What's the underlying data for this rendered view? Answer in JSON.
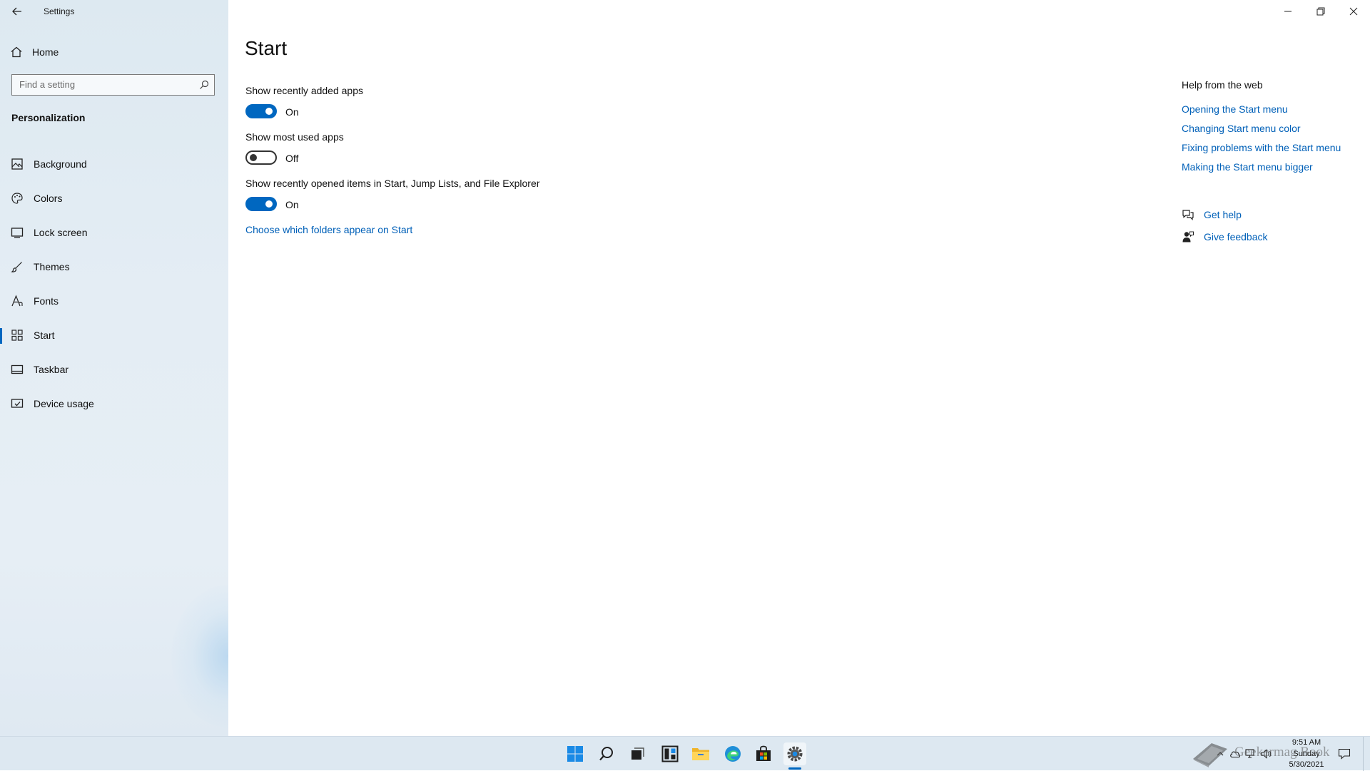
{
  "window": {
    "title": "Settings"
  },
  "sidebar": {
    "home_label": "Home",
    "search_placeholder": "Find a setting",
    "section_title": "Personalization",
    "items": [
      {
        "label": "Background",
        "icon": "image-icon"
      },
      {
        "label": "Colors",
        "icon": "palette-icon"
      },
      {
        "label": "Lock screen",
        "icon": "lock-screen-icon"
      },
      {
        "label": "Themes",
        "icon": "brush-icon"
      },
      {
        "label": "Fonts",
        "icon": "font-icon"
      },
      {
        "label": "Start",
        "icon": "start-grid-icon",
        "selected": true
      },
      {
        "label": "Taskbar",
        "icon": "taskbar-icon"
      },
      {
        "label": "Device usage",
        "icon": "device-usage-icon"
      }
    ]
  },
  "main": {
    "title": "Start",
    "settings": [
      {
        "label": "Show recently added apps",
        "state": "On"
      },
      {
        "label": "Show most used apps",
        "state": "Off"
      },
      {
        "label": "Show recently opened items in Start, Jump Lists, and File Explorer",
        "state": "On"
      }
    ],
    "folders_link": "Choose which folders appear on Start"
  },
  "help": {
    "title": "Help from the web",
    "links": [
      "Opening the Start menu",
      "Changing Start menu color",
      "Fixing problems with the Start menu",
      "Making the Start menu bigger"
    ],
    "get_help": "Get help",
    "give_feedback": "Give feedback"
  },
  "taskbar": {
    "apps": [
      "start-icon",
      "search-icon",
      "task-view-icon",
      "widgets-icon",
      "file-explorer-icon",
      "edge-icon",
      "store-icon",
      "settings-icon"
    ],
    "active_app": "settings-icon",
    "clock": {
      "time": "9:51 AM",
      "day": "Sunday",
      "date": "5/30/2021"
    },
    "watermark": "Geekermag Book"
  },
  "colors": {
    "accent": "#0067c0",
    "link": "#0060b8",
    "sidebar_bg": "#e3ecf3",
    "taskbar_bg": "#dde8f1"
  }
}
